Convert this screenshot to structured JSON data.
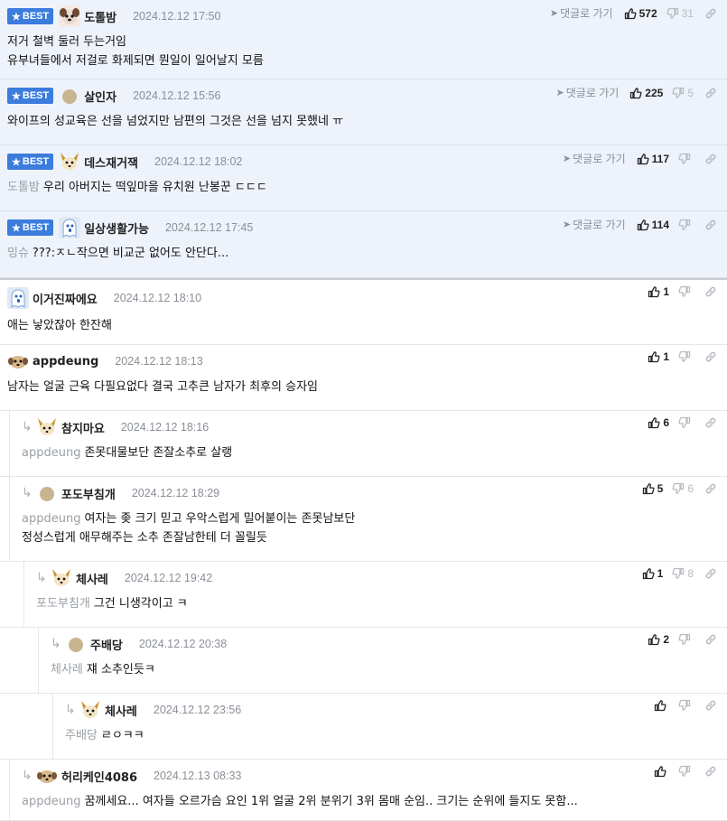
{
  "labels": {
    "best": "BEST",
    "goto": "댓글로 가기"
  },
  "comments": [
    {
      "best": true,
      "avatar": "dog-avatar",
      "nick": "도톨밤",
      "date": "2024.12.12 17:50",
      "goto": true,
      "up": "572",
      "down": "31",
      "mention": "",
      "lines": [
        "저거 철벽 둘러 두는거임",
        "유부녀들에서 저걸로 화제되면 뭔일이 일어날지 모름"
      ]
    },
    {
      "best": true,
      "avatar": "default-avatar",
      "nick": "살인자",
      "date": "2024.12.12 15:56",
      "goto": true,
      "up": "225",
      "down": "5",
      "mention": "",
      "lines": [
        "와이프의 성교육은 선을 넘었지만 남편의 그것은 선을 넘지 못했네 ㅠ"
      ]
    },
    {
      "best": true,
      "avatar": "fox-avatar",
      "nick": "데스재거잭",
      "date": "2024.12.12 18:02",
      "goto": true,
      "up": "117",
      "down": "",
      "mention": "도톨밤",
      "lines": [
        "우리 아버지는 떡잎마을 유치원 난봉꾼 ㄷㄷㄷ"
      ]
    },
    {
      "best": true,
      "avatar": "ghost-avatar",
      "nick": "일상생활가능",
      "date": "2024.12.12 17:45",
      "goto": true,
      "up": "114",
      "down": "",
      "mention": "밍슈",
      "lines": [
        "???:ㅈㄴ작으면 비교군 없어도 안단다..."
      ]
    },
    {
      "best": false,
      "avatar": "ghost-avatar",
      "nick": "이거진짜에요",
      "date": "2024.12.12 18:10",
      "goto": false,
      "up": "1",
      "down": "",
      "mention": "",
      "lines": [
        "애는 낳았잖아 한잔해"
      ]
    },
    {
      "best": false,
      "avatar": "pup-avatar",
      "nick": "appdeung",
      "date": "2024.12.12 18:13",
      "goto": false,
      "up": "1",
      "down": "",
      "mention": "",
      "lines": [
        "남자는 얼굴 근육 다필요없다 결국 고추큰 남자가 최후의 승자임"
      ]
    },
    {
      "best": false,
      "avatar": "fox-avatar",
      "nick": "참지마요",
      "date": "2024.12.12 18:16",
      "goto": false,
      "up": "6",
      "down": "",
      "mention": "appdeung",
      "lines": [
        "존못대물보단 존잘소추로 살랭"
      ]
    },
    {
      "best": false,
      "avatar": "default-avatar",
      "nick": "포도부침개",
      "date": "2024.12.12 18:29",
      "goto": false,
      "up": "5",
      "down": "6",
      "mention": "appdeung",
      "lines": [
        "여자는 좆 크기 믿고 우악스럽게 밀어붙이는 존못남보단",
        "정성스럽게 애무해주는 소추 존잘남한테 더 꼴릴듯"
      ]
    },
    {
      "best": false,
      "avatar": "fox-avatar",
      "nick": "체사레",
      "date": "2024.12.12 19:42",
      "goto": false,
      "up": "1",
      "down": "8",
      "mention": "포도부침개",
      "lines": [
        "그건 니생각이고 ㅋ"
      ]
    },
    {
      "best": false,
      "avatar": "default-avatar",
      "nick": "주배당",
      "date": "2024.12.12 20:38",
      "goto": false,
      "up": "2",
      "down": "",
      "mention": "체사레",
      "lines": [
        "쟤 소추인듯ㅋ"
      ]
    },
    {
      "best": false,
      "avatar": "fox-avatar",
      "nick": "체사레",
      "date": "2024.12.12 23:56",
      "goto": false,
      "up": "",
      "down": "",
      "mention": "주배당",
      "lines": [
        "ㄹㅇㅋㅋ"
      ]
    },
    {
      "best": false,
      "avatar": "pup-avatar",
      "nick": "허리케인4086",
      "date": "2024.12.13 08:33",
      "goto": false,
      "up": "",
      "down": "",
      "mention": "appdeung",
      "lines": [
        "꿈께세요... 여자들 오르가슴 요인 1위 얼굴 2위 분위기 3위 몸매 순임.. 크기는 순위에 들지도 못함..."
      ]
    }
  ]
}
